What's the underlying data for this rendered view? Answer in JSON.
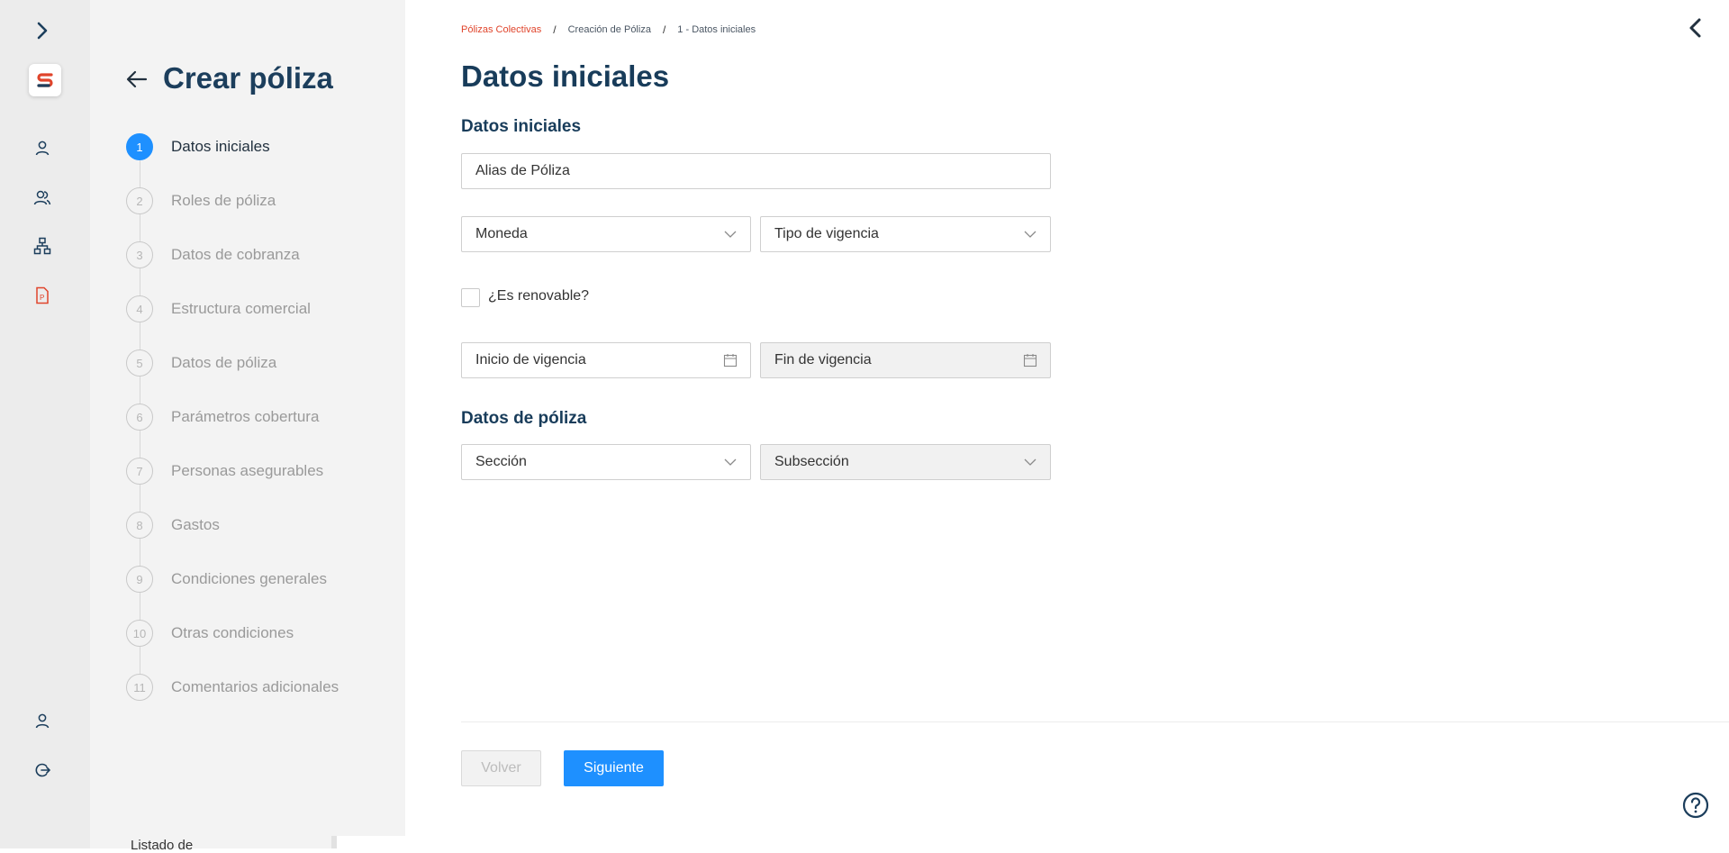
{
  "sidebar": {
    "logo_letter": "S",
    "nav_icons": [
      "user-icon",
      "users-icon",
      "hierarchy-icon",
      "document-p-icon"
    ],
    "bottom_icons": [
      "profile-icon",
      "logout-icon"
    ],
    "colors": {
      "rail": "#ececec",
      "accent": "#e0442b",
      "icon": "#1c3e5c"
    }
  },
  "steps_panel": {
    "title": "Crear póliza",
    "active_step": 1,
    "steps": [
      {
        "num": "1",
        "label": "Datos iniciales"
      },
      {
        "num": "2",
        "label": "Roles de póliza"
      },
      {
        "num": "3",
        "label": "Datos de cobranza"
      },
      {
        "num": "4",
        "label": "Estructura comercial"
      },
      {
        "num": "5",
        "label": "Datos de póliza"
      },
      {
        "num": "6",
        "label": "Parámetros cobertura"
      },
      {
        "num": "7",
        "label": "Personas asegurables"
      },
      {
        "num": "8",
        "label": "Gastos"
      },
      {
        "num": "9",
        "label": "Condiciones generales"
      },
      {
        "num": "10",
        "label": "Otras condiciones"
      },
      {
        "num": "11",
        "label": "Comentarios adicionales"
      }
    ],
    "footer_text": "Listado de"
  },
  "breadcrumb": {
    "items": [
      "Pólizas Colectivas",
      "Creación de Póliza",
      "1 - Datos iniciales"
    ],
    "separator": "/"
  },
  "main": {
    "title": "Datos iniciales",
    "section1_title": "Datos iniciales",
    "alias_placeholder": "Alias de Póliza",
    "moneda": "Moneda",
    "tipo_vigencia": "Tipo de vigencia",
    "renovable_label": "¿Es renovable?",
    "inicio_vigencia": "Inicio de vigencia",
    "fin_vigencia": "Fin de vigencia",
    "section2_title": "Datos de póliza",
    "seccion": "Sección",
    "subseccion": "Subsección"
  },
  "actions": {
    "back_label": "Volver",
    "next_label": "Siguiente",
    "primary_color": "#1e90ff"
  }
}
